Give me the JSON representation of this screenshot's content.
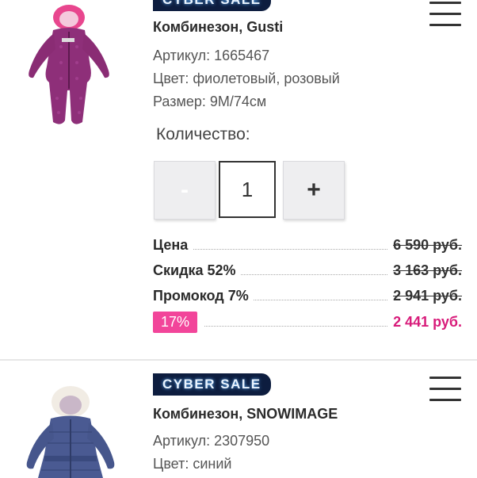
{
  "items": [
    {
      "badge": "CYBER SALE",
      "title": "Комбинезон, Gusti",
      "article": "Артикул: 1665467",
      "color": "Цвет: фиолетовый, розовый",
      "size": "Размер: 9M/74см",
      "quantity_label": "Количество:",
      "quantity": "1",
      "minus_label": "-",
      "plus_label": "+",
      "prices": [
        {
          "label": "Цена",
          "value": "6 590 руб."
        },
        {
          "label": "Скидка 52%",
          "value": "3 163 руб."
        },
        {
          "label": "Промокод 7%",
          "value": "2 941 руб."
        },
        {
          "label": "17%",
          "value": "2 441 руб."
        }
      ],
      "image_icon": "snowsuit-purple-icon"
    },
    {
      "badge": "CYBER SALE",
      "title": "Комбинезон, SNOWIMAGE",
      "article": "Артикул: 2307950",
      "color": "Цвет: синий",
      "image_icon": "snowsuit-blue-icon"
    }
  ],
  "colors": {
    "badge_bg": "#0d1d3f",
    "final_price": "#d81b7a",
    "percent_badge": "#f2459a"
  }
}
